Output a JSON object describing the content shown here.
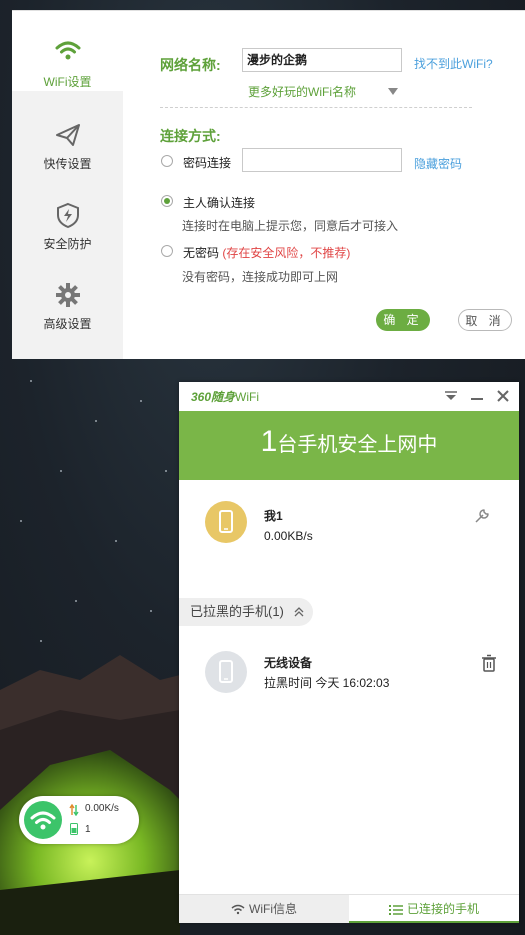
{
  "settings": {
    "nav": [
      {
        "label": "WiFi设置",
        "icon": "wifi-icon"
      },
      {
        "label": "快传设置",
        "icon": "paper-plane-icon"
      },
      {
        "label": "安全防护",
        "icon": "shield-icon"
      },
      {
        "label": "高级设置",
        "icon": "gear-icon"
      }
    ],
    "network_name_label": "网络名称:",
    "network_name_value": "漫步的企鹅",
    "cant_find_wifi": "找不到此WiFi?",
    "more_names": "更多好玩的WiFi名称",
    "connect_mode_label": "连接方式:",
    "password_option": "密码连接",
    "password_value": "",
    "hide_password": "隐藏密码",
    "owner_confirm_option": "主人确认连接",
    "owner_confirm_hint": "连接时在电脑上提示您，同意后才可接入",
    "no_password_option": "无密码",
    "no_password_warning": "(存在安全风险，不推荐)",
    "no_password_hint": "没有密码，连接成功即可上网",
    "ok_label": "确 定",
    "cancel_label": "取 消",
    "selected_mode": "owner_confirm"
  },
  "panel": {
    "brand": "360随身",
    "brand_suffix": "WiFi",
    "header_count": "1",
    "header_text": "台手机安全上网中",
    "connected_device": {
      "name": "我1",
      "speed": "0.00KB/s"
    },
    "blocked_tag": "已拉黑的手机(1)",
    "blocked_device": {
      "name": "无线设备",
      "time_label": "拉黑时间 今天 16:02:03"
    },
    "tabs": [
      {
        "label": "WiFi信息",
        "icon": "wifi-icon",
        "active": false
      },
      {
        "label": "已连接的手机",
        "icon": "list-icon",
        "active": true
      }
    ]
  },
  "widget": {
    "speed": "0.00K/s",
    "count": "1"
  },
  "colors": {
    "brand_green": "#5ea13a",
    "header_green": "#7ab648",
    "link_blue": "#4a9fdc",
    "warning_red": "#e04545",
    "widget_green": "#3cc46a"
  }
}
